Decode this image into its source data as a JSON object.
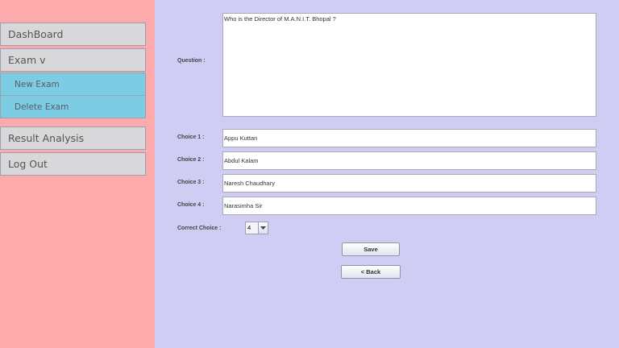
{
  "sidebar": {
    "dashboard": "DashBoard",
    "exam": "Exam  v",
    "new_exam": "New Exam",
    "delete_exam": "Delete Exam",
    "result_analysis": "Result Analysis",
    "logout": "Log Out"
  },
  "form": {
    "question_label": "Question :",
    "question_value": "Who is the Director of M.A.N.I.T. Bhopal ?",
    "choices": [
      {
        "label": "Choice 1 :",
        "value": "Appu Kuttan"
      },
      {
        "label": "Choice 2 :",
        "value": "Abdul Kalam"
      },
      {
        "label": "Choice 3 :",
        "value": "Naresh Chaudhary"
      },
      {
        "label": "Choice 4 :",
        "value": "Narasimha Sir"
      }
    ],
    "correct_label": "Correct Choice :",
    "correct_value": "4",
    "save": "Save",
    "back": "< Back"
  }
}
